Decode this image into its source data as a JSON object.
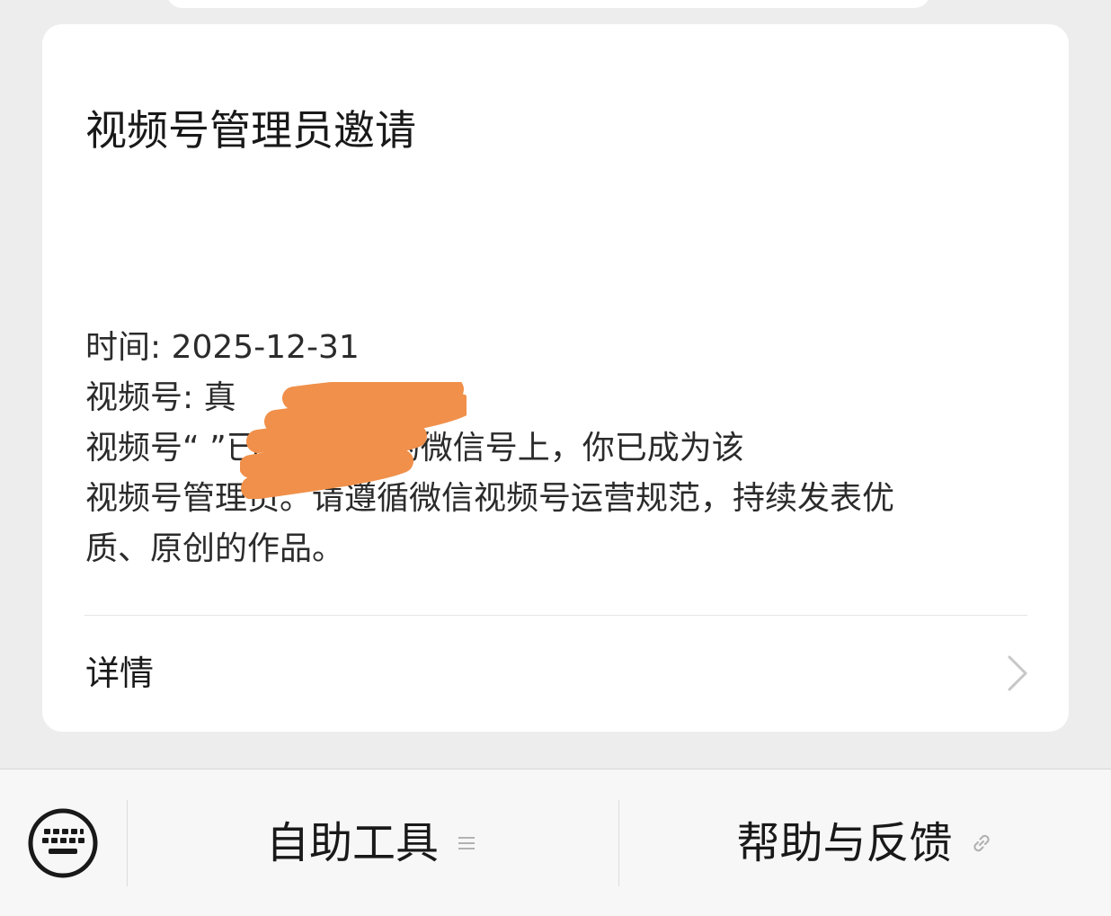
{
  "card": {
    "title": "视频号管理员邀请",
    "time_line": "时间: 2025-12-31",
    "channel_line": "视频号: 真",
    "message_lines": [
      "视频号“    ”已更换至你的微信号上，你已成为该",
      "视频号管理员。请遵循微信视频号运营规范，持续发表优",
      "质、原创的作品。"
    ],
    "detail_label": "详情"
  },
  "bottom_bar": {
    "self_service_label": "自助工具",
    "help_feedback_label": "帮助与反馈"
  },
  "colors": {
    "background": "#ededed",
    "card": "#ffffff",
    "text": "#191919",
    "redaction": "#f0904a"
  },
  "icons": {
    "keyboard": "keyboard-icon",
    "menu": "menu-lines-icon",
    "link": "link-icon",
    "chevron": "chevron-right-icon"
  }
}
